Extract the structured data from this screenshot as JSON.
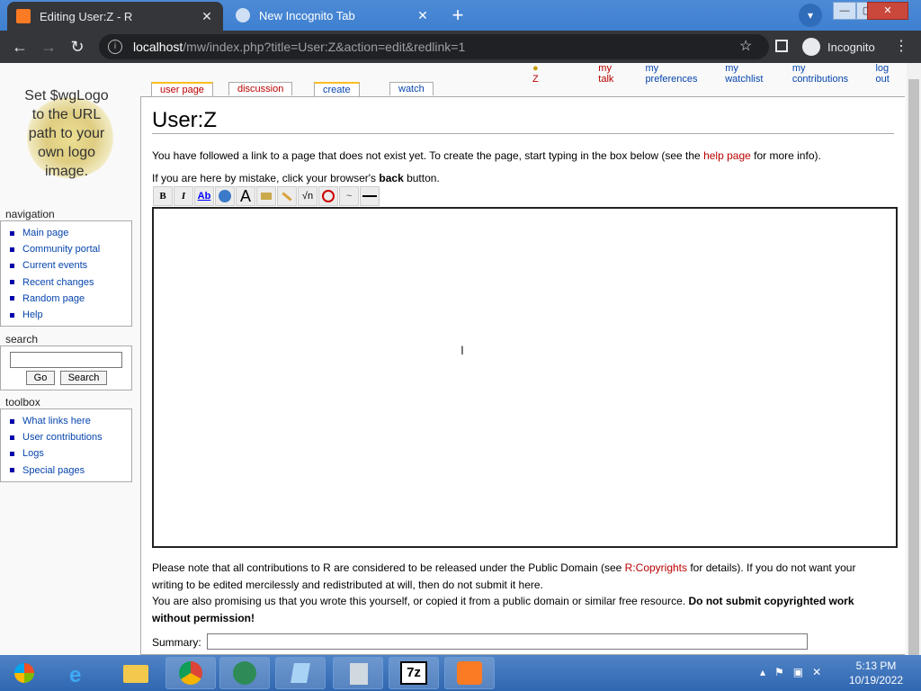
{
  "browser": {
    "tabs": [
      {
        "title": "Editing User:Z - R",
        "active": true
      },
      {
        "title": "New Incognito Tab",
        "active": false
      }
    ],
    "new_tab": "+",
    "close": "✕",
    "url_host": "localhost",
    "url_path": "/mw/index.php?title=User:Z&action=edit&redlink=1",
    "profile_label": "Incognito"
  },
  "personal": {
    "user": "Z",
    "my_talk": "my talk",
    "my_preferences": "my preferences",
    "my_watchlist": "my watchlist",
    "my_contributions": "my contributions",
    "log_out": "log out"
  },
  "tabs": {
    "user_page": "user page",
    "discussion": "discussion",
    "create": "create",
    "watch": "watch"
  },
  "logo": {
    "lines": [
      "Set $wgLogo",
      "to the URL",
      "path to your",
      "own logo",
      "image."
    ]
  },
  "navigation": {
    "heading": "navigation",
    "items": [
      "Main page",
      "Community portal",
      "Current events",
      "Recent changes",
      "Random page",
      "Help"
    ]
  },
  "search": {
    "heading": "search",
    "go": "Go",
    "search": "Search",
    "value": ""
  },
  "toolbox": {
    "heading": "toolbox",
    "items": [
      "What links here",
      "User contributions",
      "Logs",
      "Special pages"
    ]
  },
  "content": {
    "title": "User:Z",
    "intro_a": "You have followed a link to a page that does not exist yet. To create the page, start typing in the box below (see the ",
    "help_link": "help page",
    "intro_b": " for more info).",
    "mistake_a": "If you are here by mistake, click your browser's ",
    "mistake_bold": "back",
    "mistake_b": " button.",
    "note1_a": "Please note that all contributions to R are considered to be released under the Public Domain (see ",
    "copyrights_link": "R:Copyrights",
    "note1_b": " for details). If you do not want your writing to be edited mercilessly and redistributed at will, then do not submit it here.",
    "note2_a": "You are also promising us that you wrote this yourself, or copied it from a public domain or similar free resource. ",
    "note2_bold": "Do not submit copyrighted work without permission!",
    "summary_label": "Summary:",
    "summary_value": "",
    "editor_value": ""
  },
  "editor_toolbar": [
    "B",
    "I",
    "Ab",
    "globe",
    "A",
    "img",
    "media",
    "√n",
    "nowiki",
    "sig",
    "hr"
  ],
  "clock": {
    "time": "5:13 PM",
    "date": "10/19/2022"
  }
}
